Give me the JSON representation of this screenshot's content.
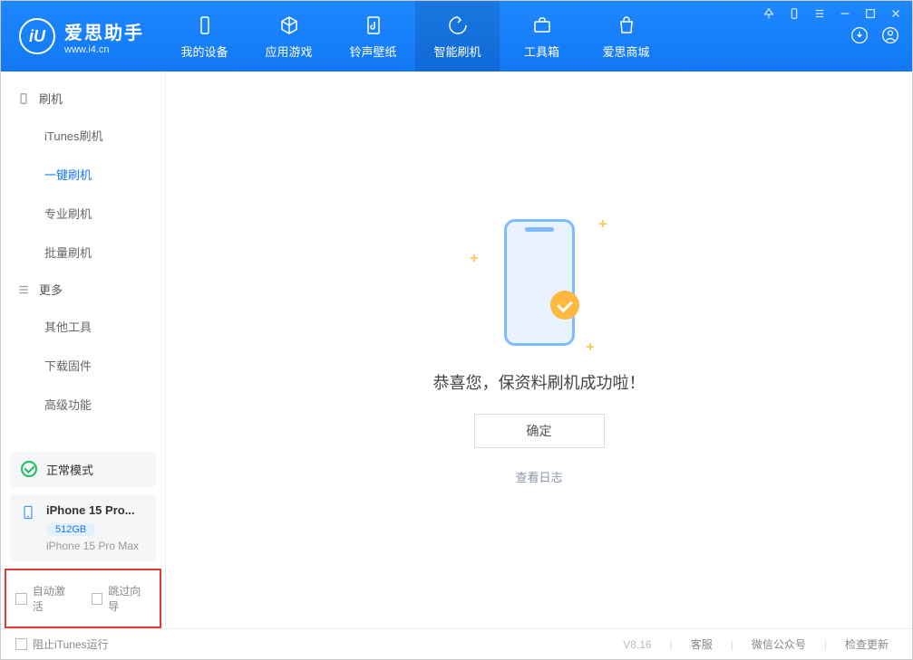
{
  "app": {
    "title": "爱思助手",
    "subtitle": "www.i4.cn"
  },
  "nav": {
    "items": [
      {
        "label": "我的设备"
      },
      {
        "label": "应用游戏"
      },
      {
        "label": "铃声壁纸"
      },
      {
        "label": "智能刷机"
      },
      {
        "label": "工具箱"
      },
      {
        "label": "爱思商城"
      }
    ]
  },
  "sidebar": {
    "group1_title": "刷机",
    "group1_items": [
      {
        "label": "iTunes刷机"
      },
      {
        "label": "一键刷机"
      },
      {
        "label": "专业刷机"
      },
      {
        "label": "批量刷机"
      }
    ],
    "group2_title": "更多",
    "group2_items": [
      {
        "label": "其他工具"
      },
      {
        "label": "下载固件"
      },
      {
        "label": "高级功能"
      }
    ]
  },
  "device_status": {
    "label": "正常模式"
  },
  "device": {
    "name": "iPhone 15 Pro...",
    "storage": "512GB",
    "full_name": "iPhone 15 Pro Max"
  },
  "options": {
    "auto_activate": "自动激活",
    "skip_wizard": "跳过向导"
  },
  "main": {
    "success_message": "恭喜您，保资料刷机成功啦！",
    "ok_button": "确定",
    "view_log": "查看日志"
  },
  "footer": {
    "block_itunes": "阻止iTunes运行",
    "version": "V8.16",
    "support": "客服",
    "wechat": "微信公众号",
    "check_update": "检查更新"
  }
}
